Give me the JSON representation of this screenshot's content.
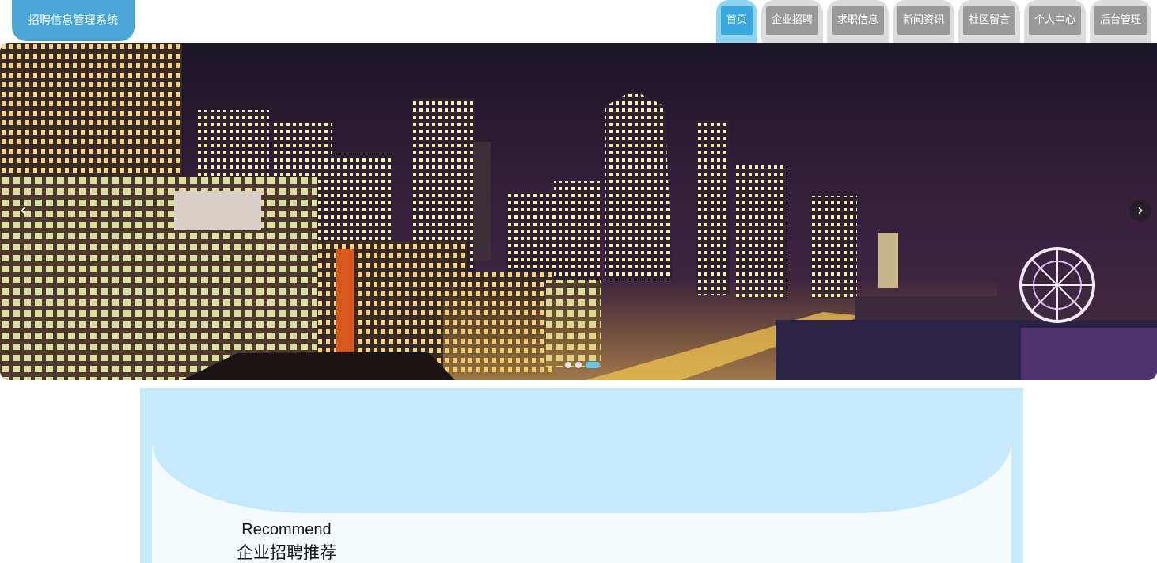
{
  "brand": {
    "title": "招聘信息管理系统"
  },
  "nav": {
    "items": [
      {
        "label": "首页",
        "active": true
      },
      {
        "label": "企业招聘",
        "active": false
      },
      {
        "label": "求职信息",
        "active": false
      },
      {
        "label": "新闻资讯",
        "active": false
      },
      {
        "label": "社区留言",
        "active": false
      },
      {
        "label": "个人中心",
        "active": false
      },
      {
        "label": "后台管理",
        "active": false
      }
    ]
  },
  "carousel": {
    "image": "city-night-skyline",
    "prev_icon": "chevron-left-icon",
    "next_icon": "chevron-right-icon",
    "prev_glyph": "‹",
    "next_glyph": "›",
    "slide_count": 3,
    "active_slide": 3
  },
  "recommend": {
    "title_en": "Recommend",
    "title_cn": "企业招聘推荐"
  },
  "colors": {
    "brand": "#4aa6d6",
    "nav_active": "#39a9df",
    "nav_inactive": "#9a9a9a",
    "section_bg": "#c6eafb"
  }
}
